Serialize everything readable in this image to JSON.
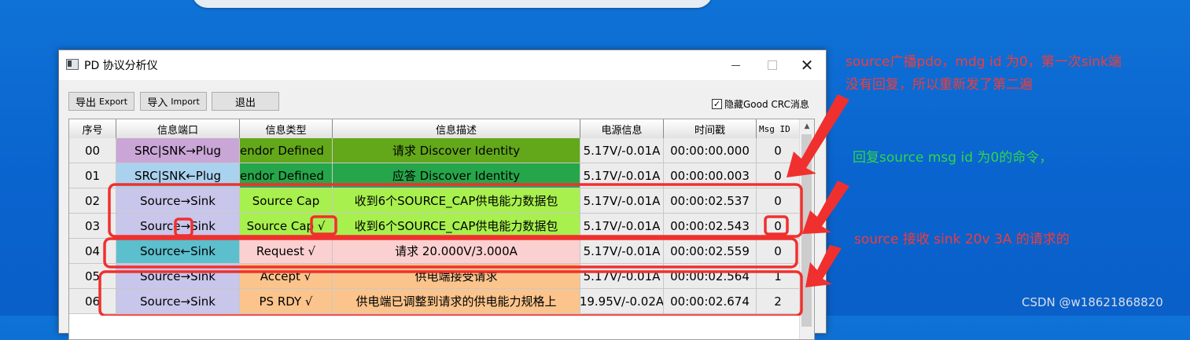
{
  "window": {
    "title": "PD 协议分析仪",
    "close_glyph": "✕"
  },
  "toolbar": {
    "export_label": "导出",
    "export_sub": "Export",
    "import_label": "导入",
    "import_sub": "Import",
    "exit_label": "退出",
    "hide_crc_label": "隐藏Good CRC消息",
    "hide_crc_checked": true,
    "check_glyph": "✓"
  },
  "table": {
    "columns": [
      "序号",
      "信息端口",
      "信息类型",
      "信息描述",
      "电源信息",
      "时间戳",
      "Msg ID"
    ],
    "rows": [
      {
        "seq": "00",
        "port": "SRC|SNK→Plug",
        "type": "endor Defined",
        "desc": "请求 Discover Identity",
        "power": "5.17V/-0.01A",
        "time": "00:00:00.000",
        "msgid": "0",
        "colors": {
          "port": "#c9a6d6",
          "type": "#63a81a",
          "desc": "#63a81a"
        }
      },
      {
        "seq": "01",
        "port": "SRC|SNK←Plug",
        "type": "endor Defined",
        "desc": "应答 Discover Identity",
        "power": "5.17V/-0.01A",
        "time": "00:00:00.003",
        "msgid": "0",
        "colors": {
          "port": "#a9d2ef",
          "type": "#26a64a",
          "desc": "#26a64a"
        }
      },
      {
        "seq": "02",
        "port": "Source→Sink",
        "type": "Source Cap",
        "desc": "收到6个SOURCE_CAP供电能力数据包",
        "power": "5.17V/-0.01A",
        "time": "00:00:02.537",
        "msgid": "0",
        "colors": {
          "port": "#c8c6ea",
          "type": "#a8f04e",
          "desc": "#a8f04e"
        }
      },
      {
        "seq": "03",
        "port": "Source→Sink",
        "type": "Source Cap √",
        "desc": "收到6个SOURCE_CAP供电能力数据包",
        "power": "5.17V/-0.01A",
        "time": "00:00:02.543",
        "msgid": "0",
        "colors": {
          "port": "#c8c6ea",
          "type": "#a8f04e",
          "desc": "#a8f04e"
        }
      },
      {
        "seq": "04",
        "port": "Source←Sink",
        "type": "Request √",
        "desc": "请求 20.000V/3.000A",
        "power": "5.17V/-0.01A",
        "time": "00:00:02.559",
        "msgid": "0",
        "colors": {
          "port": "#5bbfcd",
          "type": "#fbd0d0",
          "desc": "#fbd0d0"
        }
      },
      {
        "seq": "05",
        "port": "Source→Sink",
        "type": "Accept √",
        "desc": "供电端接受请求",
        "power": "5.17V/-0.01A",
        "time": "00:00:02.564",
        "msgid": "1",
        "colors": {
          "port": "#c8c6ea",
          "type": "#fbc48c",
          "desc": "#fbc48c"
        }
      },
      {
        "seq": "06",
        "port": "Source→Sink",
        "type": "PS RDY √",
        "desc": "供电端已调整到请求的供电能力规格上",
        "power": "19.95V/-0.02A",
        "time": "00:00:02.674",
        "msgid": "2",
        "colors": {
          "port": "#c8c6ea",
          "type": "#fbc48c",
          "desc": "#fbc48c"
        }
      }
    ]
  },
  "annotations": {
    "note1_line1": "source广播pdo，mdg id 为0，第一次sink端",
    "note1_line2": "没有回复，所以重新发了第二遍",
    "note2": "回复source msg id 为0的命令，",
    "note3": "source 接收 sink 20v 3A 的请求的",
    "red": "#f03c3c",
    "green": "#2fd64a"
  },
  "watermark": "CSDN @w18621868820"
}
